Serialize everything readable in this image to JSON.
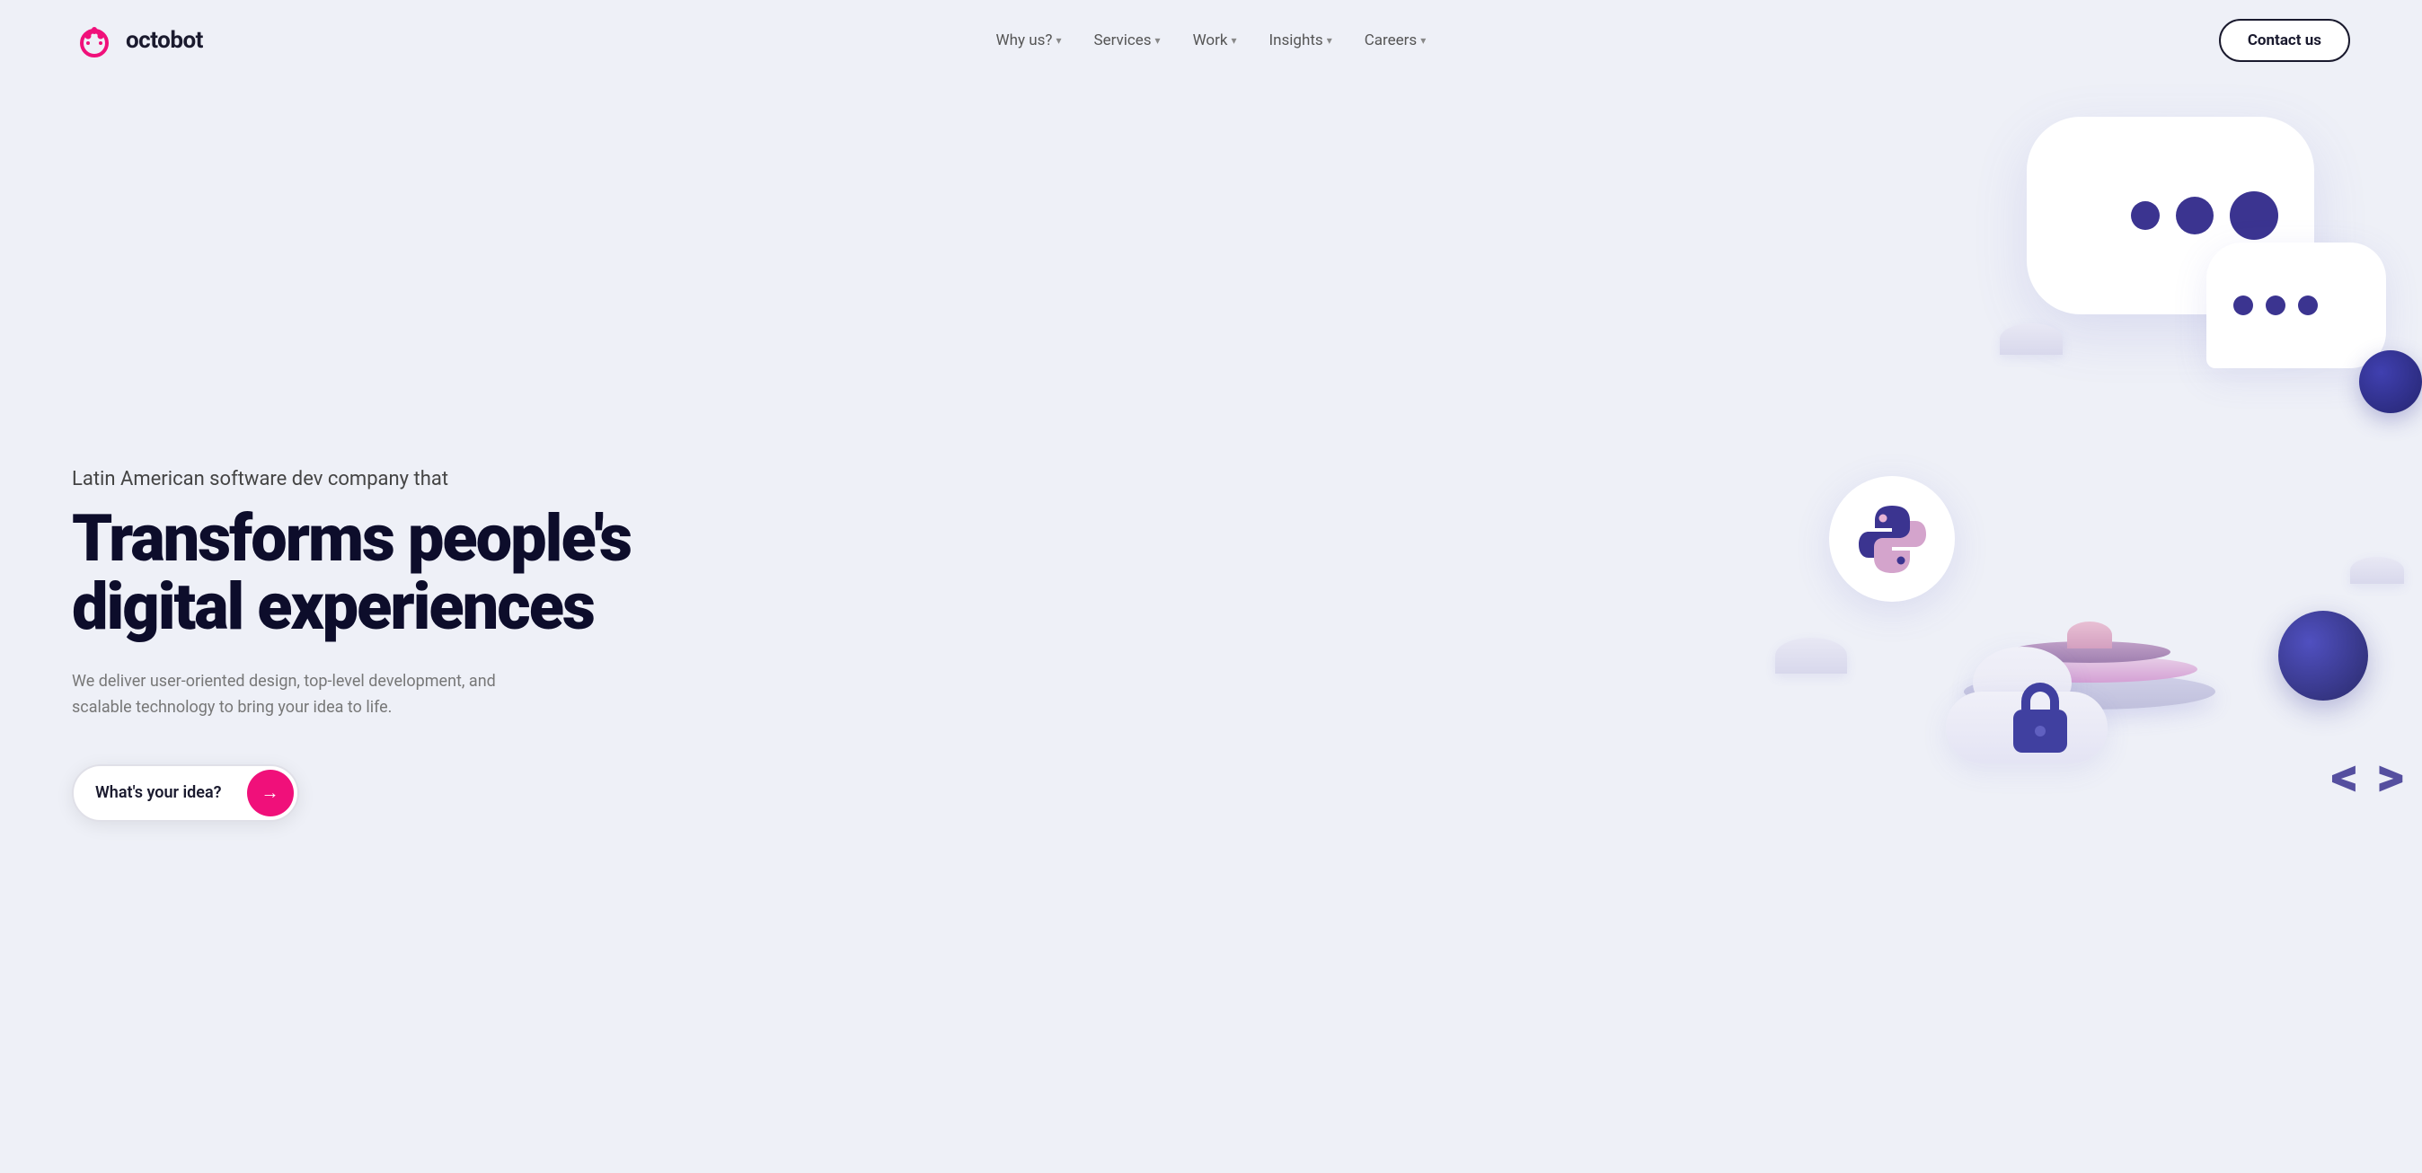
{
  "brand": {
    "name": "octobot",
    "logo_alt": "Octobot logo"
  },
  "nav": {
    "why_us_label": "Why us?",
    "services_label": "Services",
    "work_label": "Work",
    "insights_label": "Insights",
    "careers_label": "Careers",
    "contact_label": "Contact us"
  },
  "hero": {
    "subtitle": "Latin American software dev company that",
    "title_line1": "Transforms people's",
    "title_line2": "digital experiences",
    "description": "We deliver user-oriented design, top-level development, and scalable technology to bring your idea to life.",
    "cta_label": "What's your idea?",
    "cta_arrow": "→"
  },
  "colors": {
    "accent_pink": "#f0107a",
    "dark_navy": "#0d0d2b",
    "purple_deep": "#3b3490",
    "bg": "#eef0f7"
  }
}
